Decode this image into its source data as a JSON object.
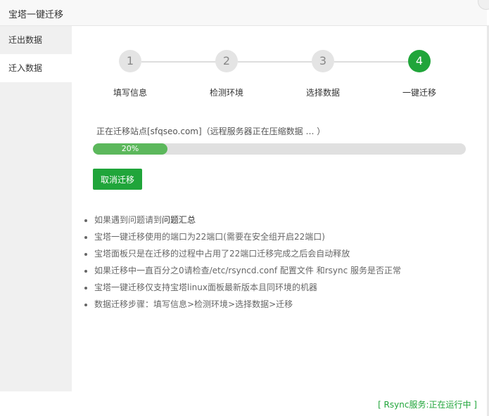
{
  "window": {
    "title": "宝塔一键迁移"
  },
  "sidebar": {
    "items": [
      {
        "label": "迁出数据"
      },
      {
        "label": "迁入数据"
      }
    ]
  },
  "steps": [
    {
      "number": "1",
      "label": "填写信息"
    },
    {
      "number": "2",
      "label": "检测环境"
    },
    {
      "number": "3",
      "label": "选择数据"
    },
    {
      "number": "4",
      "label": "一键迁移"
    }
  ],
  "current_step": 4,
  "progress": {
    "text": "正在迁移站点[sfqseo.com]（远程服务器正在压缩数据 … ）",
    "percent_label": "20%",
    "value": 20
  },
  "cancel_button": {
    "label": "取消迁移"
  },
  "tips": {
    "item1_prefix": "如果遇到问题请到",
    "item1_link": "问题汇总",
    "item2": "宝塔一键迁移使用的端口为22端口(需要在安全组开启22端口)",
    "item3": "宝塔面板只是在迁移的过程中占用了22端口迁移完成之后会自动释放",
    "item4": "如果迁移中一直百分之0请检查/etc/rsyncd.conf 配置文件 和rsync 服务是否正常",
    "item5": "宝塔一键迁移仅支持宝塔linux面板最新版本且同环境的机器",
    "item6": "数据迁移步骤：填写信息>检测环境>选择数据>迁移"
  },
  "footer": {
    "rsync_status": "[ Rsync服务:正在运行中 ]"
  },
  "colors": {
    "accent": "#20a53a",
    "progress": "#5cb85c"
  }
}
